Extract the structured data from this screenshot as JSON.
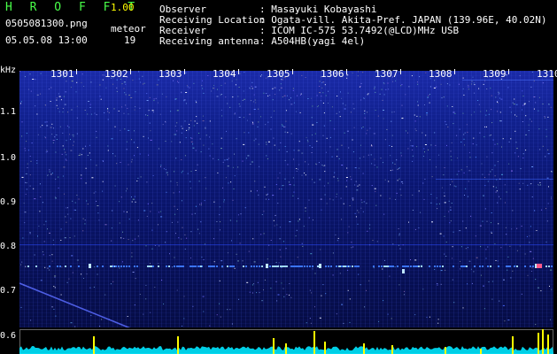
{
  "app": {
    "title": "H R O F F T",
    "version": "1.00"
  },
  "file": {
    "name": "0505081300.png",
    "datetime": "05.05.08 13:00"
  },
  "meteor": {
    "label": "meteor",
    "count": "19"
  },
  "info": [
    {
      "label": "Observer",
      "value": ": Masayuki Kobayashi"
    },
    {
      "label": "Receiving Location",
      "value": ": Ogata-vill. Akita-Pref. JAPAN (139.96E, 40.02N)"
    },
    {
      "label": "Receiver",
      "value": ": ICOM IC-575 53.7492(@LCD)MHz USB"
    },
    {
      "label": "Receiving antenna",
      "value": ": A504HB(yagi 4el)"
    }
  ],
  "y_axis": {
    "unit": "kHz",
    "ticks": [
      "1.1",
      "1.0",
      "0.9",
      "0.8",
      "0.7",
      "0.6"
    ]
  },
  "x_axis": {
    "ticks": [
      "1301",
      "1302",
      "1303",
      "1304",
      "1305",
      "1306",
      "1307",
      "1308",
      "1309",
      "1310"
    ]
  },
  "colors": {
    "title_green": "#49ff49",
    "version_yellow": "#ffff00",
    "signal_blue": "#1a2aa8",
    "activity_cyan": "#00e5ff",
    "burst_yellow": "#ffff00"
  }
}
